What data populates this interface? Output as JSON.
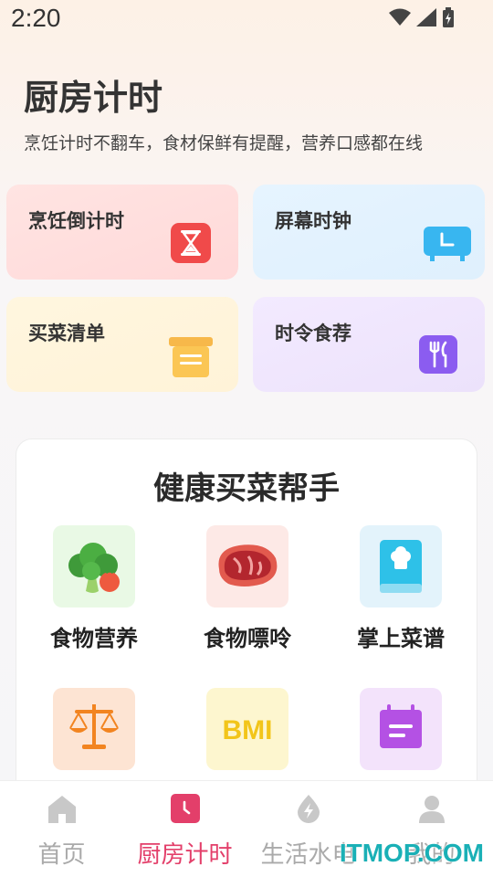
{
  "status_bar": {
    "time": "2:20",
    "icons": [
      "wifi-icon",
      "signal-icon",
      "battery-icon"
    ]
  },
  "header": {
    "title": "厨房计时",
    "subtitle": "烹饪计时不翻车，食材保鲜有提醒，营养口感都在线"
  },
  "cards": {
    "countdown": {
      "label": "烹饪倒计时",
      "icon": "hourglass-icon"
    },
    "clock": {
      "label": "屏幕时钟",
      "icon": "screen-clock-icon"
    },
    "shopping": {
      "label": "买菜清单",
      "icon": "archive-box-icon"
    },
    "seasonal": {
      "label": "时令食荐",
      "icon": "fork-knife-icon"
    }
  },
  "helper": {
    "title": "健康买菜帮手",
    "tools": [
      {
        "label": "食物营养",
        "icon": "broccoli-icon"
      },
      {
        "label": "食物嘌呤",
        "icon": "steak-icon"
      },
      {
        "label": "掌上菜谱",
        "icon": "recipe-book-icon"
      },
      {
        "label": "",
        "icon": "scale-icon"
      },
      {
        "label": "BMI",
        "icon": "bmi-icon"
      },
      {
        "label": "",
        "icon": "calendar-icon"
      }
    ]
  },
  "bottom_nav": {
    "items": [
      {
        "label": "首页",
        "icon": "home-icon"
      },
      {
        "label": "厨房计时",
        "icon": "clock-icon",
        "active": true
      },
      {
        "label": "生活水电",
        "icon": "lightning-icon"
      },
      {
        "label": "我的",
        "icon": "user-icon"
      }
    ]
  },
  "watermark": "ITMOP.COM",
  "colors": {
    "accent": "#e33f6a",
    "nav_inactive": "#aaaaaa"
  }
}
